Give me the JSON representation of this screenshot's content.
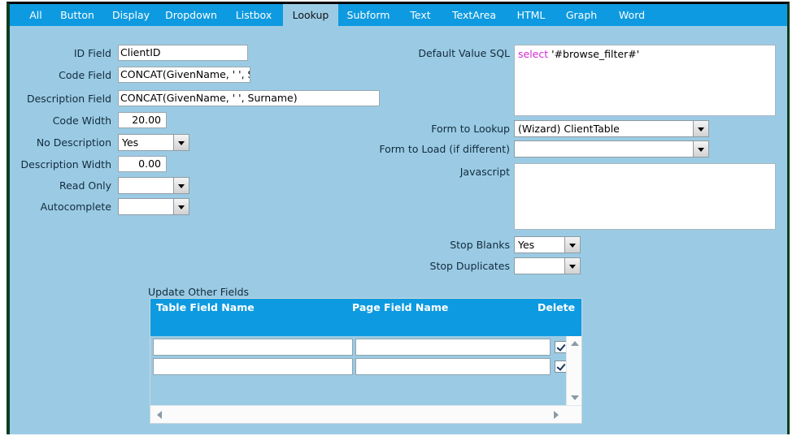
{
  "colors": {
    "page_background": "#9bcbe4",
    "tab_bar": "#0e9ae0",
    "tab_active_background": "#9bcbe4",
    "grid_header": "#0e9ae0",
    "label_text": "#122b3d",
    "sql_keyword": "#d42ad4",
    "border_left": "#0b3d1f"
  },
  "tabs": [
    {
      "label": "All",
      "active": false
    },
    {
      "label": "Button",
      "active": false
    },
    {
      "label": "Display",
      "active": false
    },
    {
      "label": "Dropdown",
      "active": false
    },
    {
      "label": "Listbox",
      "active": false
    },
    {
      "label": "Lookup",
      "active": true
    },
    {
      "label": "Subform",
      "active": false
    },
    {
      "label": "Text",
      "active": false
    },
    {
      "label": "TextArea",
      "active": false
    },
    {
      "label": "HTML",
      "active": false
    },
    {
      "label": "Graph",
      "active": false
    },
    {
      "label": "Word",
      "active": false
    }
  ],
  "left_form": {
    "id_field": {
      "label": "ID Field",
      "value": "ClientID"
    },
    "code_field": {
      "label": "Code Field",
      "value": "CONCAT(GivenName, ' ', Su"
    },
    "description_field": {
      "label": "Description Field",
      "value": "CONCAT(GivenName, ' ', Surname)"
    },
    "code_width": {
      "label": "Code Width",
      "value": "20.00"
    },
    "no_description": {
      "label": "No Description",
      "value": "Yes"
    },
    "description_width": {
      "label": "Description Width",
      "value": "0.00"
    },
    "read_only": {
      "label": "Read Only",
      "value": ""
    },
    "autocomplete": {
      "label": "Autocomplete",
      "value": ""
    }
  },
  "right_form": {
    "default_value_sql": {
      "label": "Default Value SQL",
      "keyword": "select",
      "rest": " '#browse_filter#'"
    },
    "form_to_lookup": {
      "label": "Form to Lookup",
      "value": "(Wizard) ClientTable"
    },
    "form_to_load": {
      "label": "Form to Load (if different)",
      "value": ""
    },
    "javascript": {
      "label": "Javascript",
      "value": ""
    },
    "stop_blanks": {
      "label": "Stop Blanks",
      "value": "Yes"
    },
    "stop_duplicates": {
      "label": "Stop Duplicates",
      "value": ""
    }
  },
  "update_other_fields": {
    "title": "Update Other Fields",
    "columns": [
      "Table Field Name",
      "Page Field Name",
      "Delete"
    ],
    "rows": [
      {
        "table_field_name": "",
        "page_field_name": "",
        "delete_checked": true
      },
      {
        "table_field_name": "",
        "page_field_name": "",
        "delete_checked": true
      }
    ]
  }
}
